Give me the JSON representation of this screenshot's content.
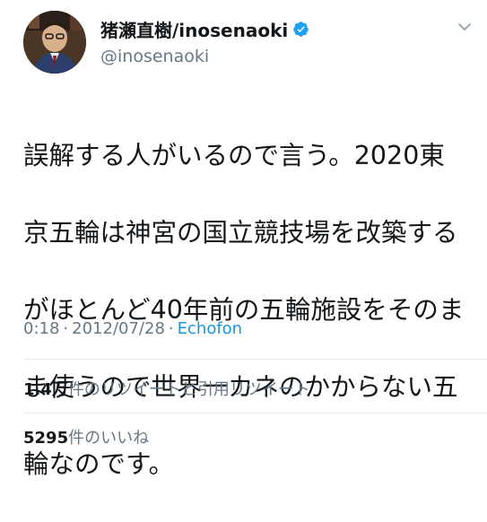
{
  "header": {
    "display_name": "猪瀬直樹/inosenaoki",
    "handle": "@inosenaoki",
    "verified": true,
    "icons": [
      "avatar",
      "verified-badge-icon",
      "chevron-down-icon"
    ]
  },
  "tweet": {
    "lines": [
      "誤解する人がいるので言う。2020東",
      "京五輪は神宮の国立競技場を改築する",
      "がほとんど40年前の五輪施設をそのま",
      "ま使うので世界一カネのかからない五",
      "輪なのです。"
    ]
  },
  "meta": {
    "time": "0:18",
    "separator": "·",
    "date": "2012/07/28",
    "separator2": "·",
    "source": "Echofon"
  },
  "stats": {
    "retweets_count": "1.4万",
    "retweets_label": "件のリツイートと引用リツイート",
    "likes_count": "5295",
    "likes_label": "件のいいね"
  },
  "colors": {
    "text": "#14171a",
    "secondary": "#657786",
    "link": "#1b95e0",
    "verified": "#1da1f2",
    "divider": "#e6ecf0"
  }
}
